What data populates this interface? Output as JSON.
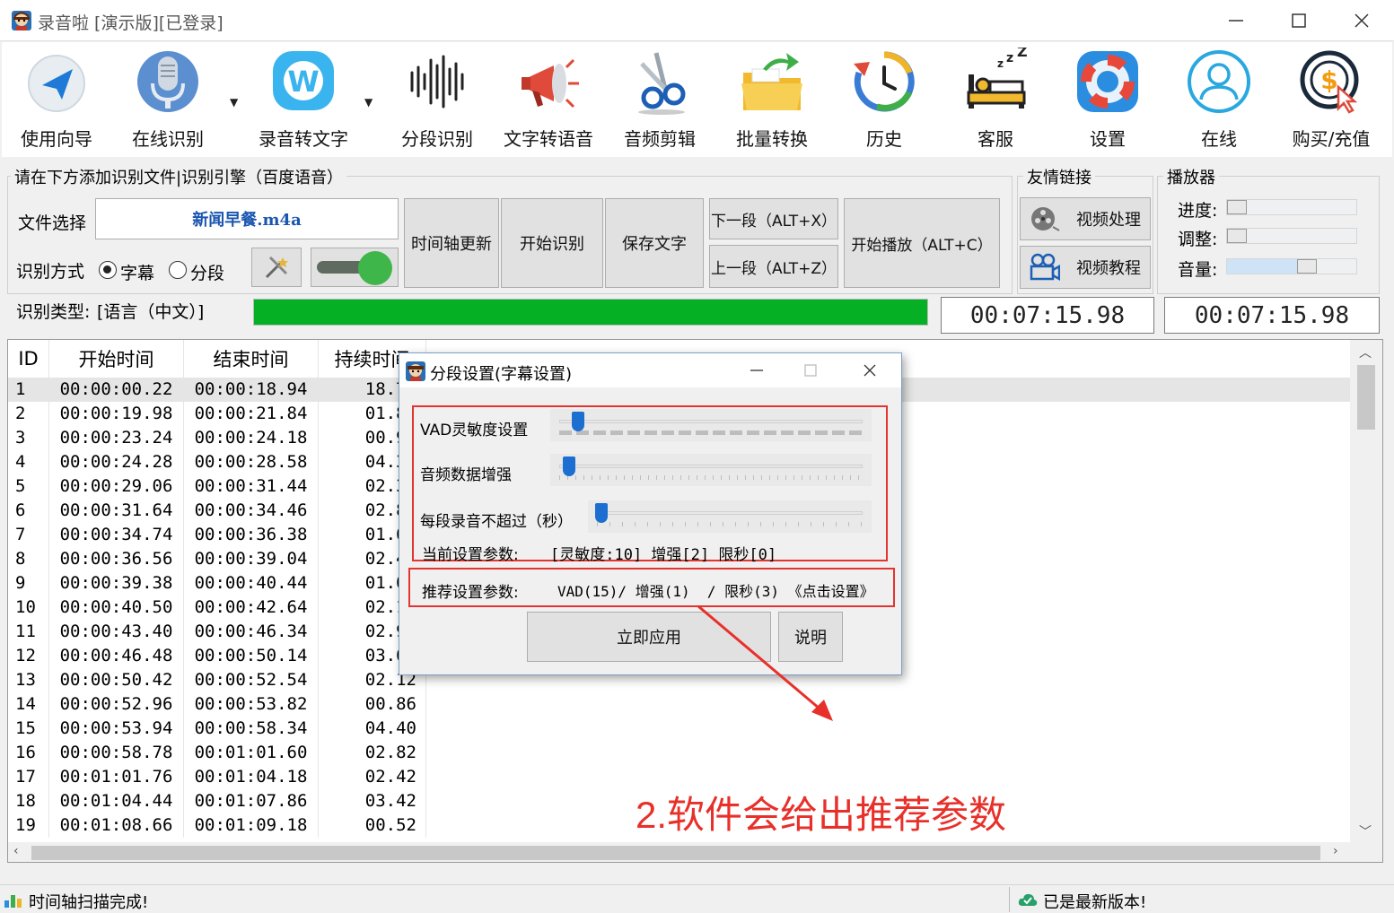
{
  "window": {
    "title": "录音啦 [演示版][已登录]"
  },
  "toolbar": {
    "items": [
      {
        "label": "使用向导",
        "icon": "navigation-arrow-icon"
      },
      {
        "label": "在线识别",
        "icon": "microphone-icon"
      },
      {
        "label": "录音转文字",
        "icon": "w-bubble-icon"
      },
      {
        "label": "分段识别",
        "icon": "waveform-icon"
      },
      {
        "label": "文字转语音",
        "icon": "megaphone-icon"
      },
      {
        "label": "音频剪辑",
        "icon": "scissors-icon"
      },
      {
        "label": "批量转换",
        "icon": "folder-arrow-icon"
      },
      {
        "label": "历史",
        "icon": "history-clock-icon"
      },
      {
        "label": "客服",
        "icon": "sleeping-bed-icon"
      },
      {
        "label": "设置",
        "icon": "lifebuoy-icon"
      },
      {
        "label": "在线",
        "icon": "user-circle-icon"
      },
      {
        "label": "购买/充值",
        "icon": "dollar-coin-icon"
      }
    ]
  },
  "panel": {
    "group_title": "请在下方添加识别文件|识别引擎（百度语音）",
    "file_label": "文件选择",
    "file_name": "新闻早餐.m4a",
    "mode_label": "识别方式",
    "mode_subtitle": "字幕",
    "mode_segment": "分段",
    "type_label": "识别类型:",
    "type_value": "[语言（中文）]",
    "btn_timeline": "时间轴更新",
    "btn_start": "开始识别",
    "btn_save": "保存文字",
    "btn_next": "下一段（ALT+X）",
    "btn_prev": "上一段（ALT+Z）",
    "btn_play": "开始播放（ALT+C）",
    "progress_percent": 100,
    "time1": "00:07:15.98",
    "time2": "00:07:15.98"
  },
  "links": {
    "title": "友情链接",
    "video_process": "视频处理",
    "video_tutorial": "视频教程"
  },
  "player": {
    "title": "播放器",
    "progress_label": "进度:",
    "adjust_label": "调整:",
    "volume_label": "音量:",
    "volume_level": 0.62
  },
  "table": {
    "headers": [
      "ID",
      "开始时间",
      "结束时间",
      "持续时间"
    ],
    "rows": [
      [
        "1",
        "00:00:00.22",
        "00:00:18.94",
        "18.72"
      ],
      [
        "2",
        "00:00:19.98",
        "00:00:21.84",
        "01.86"
      ],
      [
        "3",
        "00:00:23.24",
        "00:00:24.18",
        "00.94"
      ],
      [
        "4",
        "00:00:24.28",
        "00:00:28.58",
        "04.30"
      ],
      [
        "5",
        "00:00:29.06",
        "00:00:31.44",
        "02.38"
      ],
      [
        "6",
        "00:00:31.64",
        "00:00:34.46",
        "02.82"
      ],
      [
        "7",
        "00:00:34.74",
        "00:00:36.38",
        "01.64"
      ],
      [
        "8",
        "00:00:36.56",
        "00:00:39.04",
        "02.48"
      ],
      [
        "9",
        "00:00:39.38",
        "00:00:40.44",
        "01.06"
      ],
      [
        "10",
        "00:00:40.50",
        "00:00:42.64",
        "02.14"
      ],
      [
        "11",
        "00:00:43.40",
        "00:00:46.34",
        "02.94"
      ],
      [
        "12",
        "00:00:46.48",
        "00:00:50.14",
        "03.66"
      ],
      [
        "13",
        "00:00:50.42",
        "00:00:52.54",
        "02.12"
      ],
      [
        "14",
        "00:00:52.96",
        "00:00:53.82",
        "00.86"
      ],
      [
        "15",
        "00:00:53.94",
        "00:00:58.34",
        "04.40"
      ],
      [
        "16",
        "00:00:58.78",
        "00:01:01.60",
        "02.82"
      ],
      [
        "17",
        "00:01:01.76",
        "00:01:04.18",
        "02.42"
      ],
      [
        "18",
        "00:01:04.44",
        "00:01:07.86",
        "03.42"
      ],
      [
        "19",
        "00:01:08.66",
        "00:01:09.18",
        "00.52"
      ]
    ]
  },
  "dialog": {
    "title": "分段设置(字幕设置)",
    "vad_label": "VAD灵敏度设置",
    "enhance_label": "音频数据增强",
    "limit_label": "每段录音不超过（秒）",
    "current_label": "当前设置参数:",
    "current_value": "[灵敏度:10] 增强[2] 限秒[0]",
    "recommend_label": "推荐设置参数:",
    "recommend_value": "VAD(15)/ 增强(1)  / 限秒(3) 《点击设置》",
    "apply": "立即应用",
    "help": "说明"
  },
  "annotation": {
    "text": "2.软件会给出推荐参数",
    "color": "#e8302a"
  },
  "status": {
    "left": "时间轴扫描完成!",
    "right": "已是最新版本!"
  }
}
